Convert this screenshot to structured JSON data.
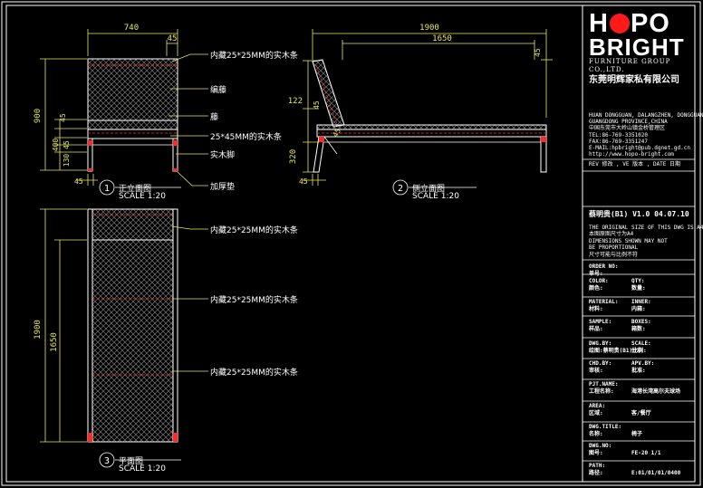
{
  "views": {
    "front": {
      "number": "1",
      "title": "正立面图",
      "scale": "SCALE 1:20"
    },
    "side": {
      "number": "2",
      "title": "侧立面图",
      "scale": "SCALE 1:20"
    },
    "plan": {
      "number": "3",
      "title": "平面图",
      "scale": "SCALE 1:20"
    }
  },
  "dims": {
    "front_width": "740",
    "front_top": "45",
    "front_900": "900",
    "front_45a": "45",
    "front_400": "400",
    "front_45b": "45",
    "front_130": "130",
    "front_45c": "45",
    "side_1900": "1900",
    "side_1650": "1650",
    "side_45r": "45",
    "side_122": "122",
    "side_45m": "45",
    "side_45s": "45",
    "side_320": "320",
    "side_45b": "45",
    "plan_1900": "1900",
    "plan_1650": "1650"
  },
  "callouts": {
    "front": [
      "内藏25*25MM的实木条",
      "编藤",
      "藤",
      "25*45MM的实木条",
      "实木脚",
      "加厚垫"
    ],
    "plan": [
      "内藏25*25MM的实木条",
      "内藏25*25MM的实木条",
      "内藏25*25MM的实木条"
    ]
  },
  "titleblock": {
    "brand_line1_a": "H",
    "brand_line1_b": "PO",
    "brand_line2": "BRIGHT",
    "brand_sub": "FURNITURE GROUP CO.,LTD.",
    "company_cn": "东莞明辉家私有限公司",
    "address_lines": [
      "HUAN DONGGUAN, DALANGZHEN, DONGGUAN",
      "GUANGDONG PROVINCE,CHINA",
      "中国东莞市大岭山镇金桥管理区",
      "TEL:86-769-3351020",
      "FAX:86-769-3351247",
      "E-MAIL:hpbright@pub.dgnet.gd.cn",
      "http://www.hopo-bright.com"
    ],
    "rev_header": "REV 修改 , VE 版本 , DATE 日期",
    "rev_entry": "蔡明贵(B1) V1.0    04.07.10",
    "notice": [
      "THE ORIGINAL SIZE OF THIS DWG IS A4",
      "本图原图尺寸为A4",
      "DIMENSIONS SHOWN MAY NOT",
      "BE PROPORTIONAL",
      "尺寸可能与比例不符"
    ],
    "fields": [
      [
        "ORDER NO:",
        ""
      ],
      [
        "单号:",
        ""
      ],
      [
        "COLOR:",
        "QTY:"
      ],
      [
        "颜色:",
        "数量:"
      ],
      [
        "MATERIAL:",
        "INNER:"
      ],
      [
        "材料:",
        "内箱:"
      ],
      [
        "SAMPLE:",
        "BOXES:"
      ],
      [
        "样品:",
        "箱数:"
      ],
      [
        "DWG.BY:",
        "SCALE:"
      ],
      [
        "绘图:蔡明贵(B1)比例:",
        "分示"
      ],
      [
        "CHD.BY:",
        "APV.BY:"
      ],
      [
        "审核:",
        "批准:"
      ],
      [
        "PJT.NAME:",
        ""
      ],
      [
        "工程名称:",
        "海港长湾高尔夫球场"
      ],
      [
        "AREA:",
        ""
      ],
      [
        "区域:",
        "客/餐厅"
      ],
      [
        "DWG.TITLE:",
        ""
      ],
      [
        "名称:",
        "椅子"
      ],
      [
        "DWG.NO:",
        ""
      ],
      [
        "图号:",
        "FE-20     1/1"
      ],
      [
        "PATH:",
        ""
      ],
      [
        "路径:",
        "E:01/01/01/0400"
      ]
    ]
  },
  "colors": {
    "background": "#000000",
    "frame": "#ffffff",
    "dimension": "#e6e65a",
    "hatch": "#8c8c8c",
    "red_marks": "#ff2a2a",
    "brand_red": "#ff1a1a"
  }
}
